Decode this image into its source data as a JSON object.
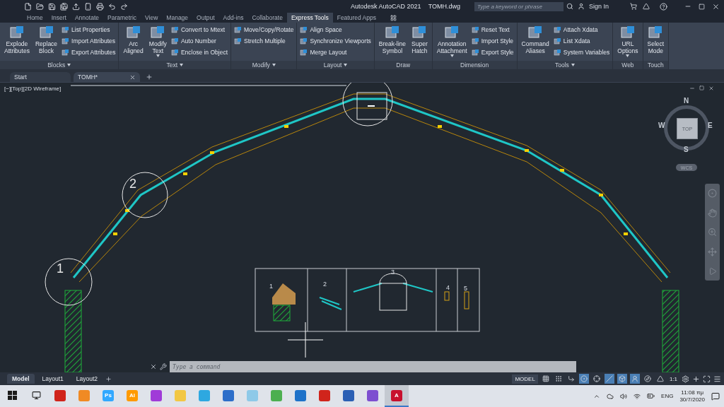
{
  "title_bar": {
    "app_title": "Autodesk AutoCAD 2021",
    "file_name": "TOMH.dwg",
    "search": {
      "placeholder": "Type a keyword or phrase"
    },
    "sign_in": "Sign In"
  },
  "ribbon_tabs": [
    {
      "label": "Home",
      "selected": false
    },
    {
      "label": "Insert",
      "selected": false
    },
    {
      "label": "Annotate",
      "selected": false
    },
    {
      "label": "Parametric",
      "selected": false
    },
    {
      "label": "View",
      "selected": false
    },
    {
      "label": "Manage",
      "selected": false
    },
    {
      "label": "Output",
      "selected": false
    },
    {
      "label": "Add-ins",
      "selected": false
    },
    {
      "label": "Collaborate",
      "selected": false
    },
    {
      "label": "Express Tools",
      "selected": true
    },
    {
      "label": "Featured Apps",
      "selected": false
    }
  ],
  "ribbon_panels": [
    {
      "title": "Blocks",
      "menu": true,
      "tools": [
        {
          "label": "Explode\nAttributes",
          "kind": "large",
          "dropdown": false
        },
        {
          "label": "Replace\nBlock",
          "kind": "large",
          "dropdown": false
        },
        {
          "label": "List Properties",
          "kind": "small",
          "dropdown": false
        },
        {
          "label": "Import Attributes",
          "kind": "small",
          "dropdown": false
        },
        {
          "label": "Export Attributes",
          "kind": "small",
          "dropdown": false
        }
      ]
    },
    {
      "title": "Text",
      "menu": true,
      "tools": [
        {
          "label": "Arc\nAligned",
          "kind": "large",
          "dropdown": false
        },
        {
          "label": "Modify\nText",
          "kind": "large",
          "dropdown": true
        },
        {
          "label": "Convert to Mtext",
          "kind": "small",
          "dropdown": false
        },
        {
          "label": "Auto Number",
          "kind": "small",
          "dropdown": false
        },
        {
          "label": "Enclose in Object",
          "kind": "small",
          "dropdown": false
        }
      ]
    },
    {
      "title": "Modify",
      "menu": true,
      "tools": [
        {
          "label": "Move/Copy/Rotate",
          "kind": "small",
          "dropdown": false
        },
        {
          "label": "Stretch Multiple",
          "kind": "small",
          "dropdown": false
        }
      ]
    },
    {
      "title": "Layout",
      "menu": true,
      "tools": [
        {
          "label": "Align Space",
          "kind": "small",
          "dropdown": false
        },
        {
          "label": "Synchronize Viewports",
          "kind": "small",
          "dropdown": false
        },
        {
          "label": "Merge Layout",
          "kind": "small",
          "dropdown": false
        }
      ]
    },
    {
      "title": "Draw",
      "menu": false,
      "tools": [
        {
          "label": "Break-line\nSymbol",
          "kind": "large",
          "dropdown": false
        },
        {
          "label": "Super\nHatch",
          "kind": "large",
          "dropdown": false
        }
      ]
    },
    {
      "title": "Dimension",
      "menu": false,
      "tools": [
        {
          "label": "Annotation\nAttachment",
          "kind": "large",
          "dropdown": true
        },
        {
          "label": "Reset Text",
          "kind": "small",
          "dropdown": false
        },
        {
          "label": "Import Style",
          "kind": "small",
          "dropdown": false
        },
        {
          "label": "Export Style",
          "kind": "small",
          "dropdown": false
        }
      ]
    },
    {
      "title": "Tools",
      "menu": true,
      "tools": [
        {
          "label": "Command\nAliases",
          "kind": "large",
          "dropdown": false
        },
        {
          "label": "Attach Xdata",
          "kind": "small",
          "dropdown": false
        },
        {
          "label": "List Xdata",
          "kind": "small",
          "dropdown": false
        },
        {
          "label": "System Variables",
          "kind": "small",
          "dropdown": false
        }
      ]
    },
    {
      "title": "Web",
      "menu": false,
      "tools": [
        {
          "label": "URL\nOptions",
          "kind": "large",
          "dropdown": true
        }
      ]
    },
    {
      "title": "Touch",
      "menu": false,
      "tools": [
        {
          "label": "Select\nMode",
          "kind": "large",
          "dropdown": false
        }
      ]
    }
  ],
  "file_tabs": [
    {
      "label": "Start",
      "selected": false,
      "closable": false
    },
    {
      "label": "TOMH*",
      "selected": true,
      "closable": true
    }
  ],
  "viewport": {
    "label": "[−][Top][2D Wireframe]",
    "viewcube": {
      "face": "TOP",
      "north": "N",
      "south": "S",
      "east": "E",
      "west": "W"
    },
    "ucs": "WCS",
    "callouts": [
      "1",
      "2"
    ],
    "detail_numbers": [
      "1",
      "2",
      "3",
      "4",
      "5"
    ]
  },
  "command_line": {
    "placeholder": "Type a command"
  },
  "layout_tabs": [
    {
      "label": "Model",
      "selected": true
    },
    {
      "label": "Layout1",
      "selected": false
    },
    {
      "label": "Layout2",
      "selected": false
    }
  ],
  "status_bar": {
    "space": "MODEL",
    "scale": "1:1",
    "toggles": [
      {
        "on": false
      },
      {
        "on": false
      },
      {
        "on": false
      },
      {
        "on": true
      },
      {
        "on": false
      },
      {
        "on": true
      },
      {
        "on": true
      },
      {
        "on": true
      },
      {
        "on": false
      },
      {
        "on": false
      }
    ]
  },
  "taskbar": {
    "apps": [
      {
        "color": "#d0241b",
        "active": false
      },
      {
        "color": "#f08a24",
        "active": false
      },
      {
        "label": "Ps",
        "color": "#31a8ff",
        "active": false
      },
      {
        "label": "Ai",
        "color": "#ff9a00",
        "active": false
      },
      {
        "color": "#a03bd8",
        "active": false
      },
      {
        "color": "#f2c744",
        "active": false
      },
      {
        "color": "#2ea8e0",
        "active": false
      },
      {
        "color": "#2d6ec9",
        "active": false
      },
      {
        "color": "#8ec9e8",
        "active": false
      },
      {
        "color": "#4caf50",
        "active": false
      },
      {
        "color": "#1e72c9",
        "active": false
      },
      {
        "color": "#d0241b",
        "active": false
      },
      {
        "color": "#2b5fb4",
        "active": false
      },
      {
        "color": "#7d4fd0",
        "active": false
      },
      {
        "label": "A",
        "color": "#c8102e",
        "active": true
      }
    ],
    "language": "ENG",
    "time": "11:08 πμ",
    "date": "30/7/2020"
  }
}
